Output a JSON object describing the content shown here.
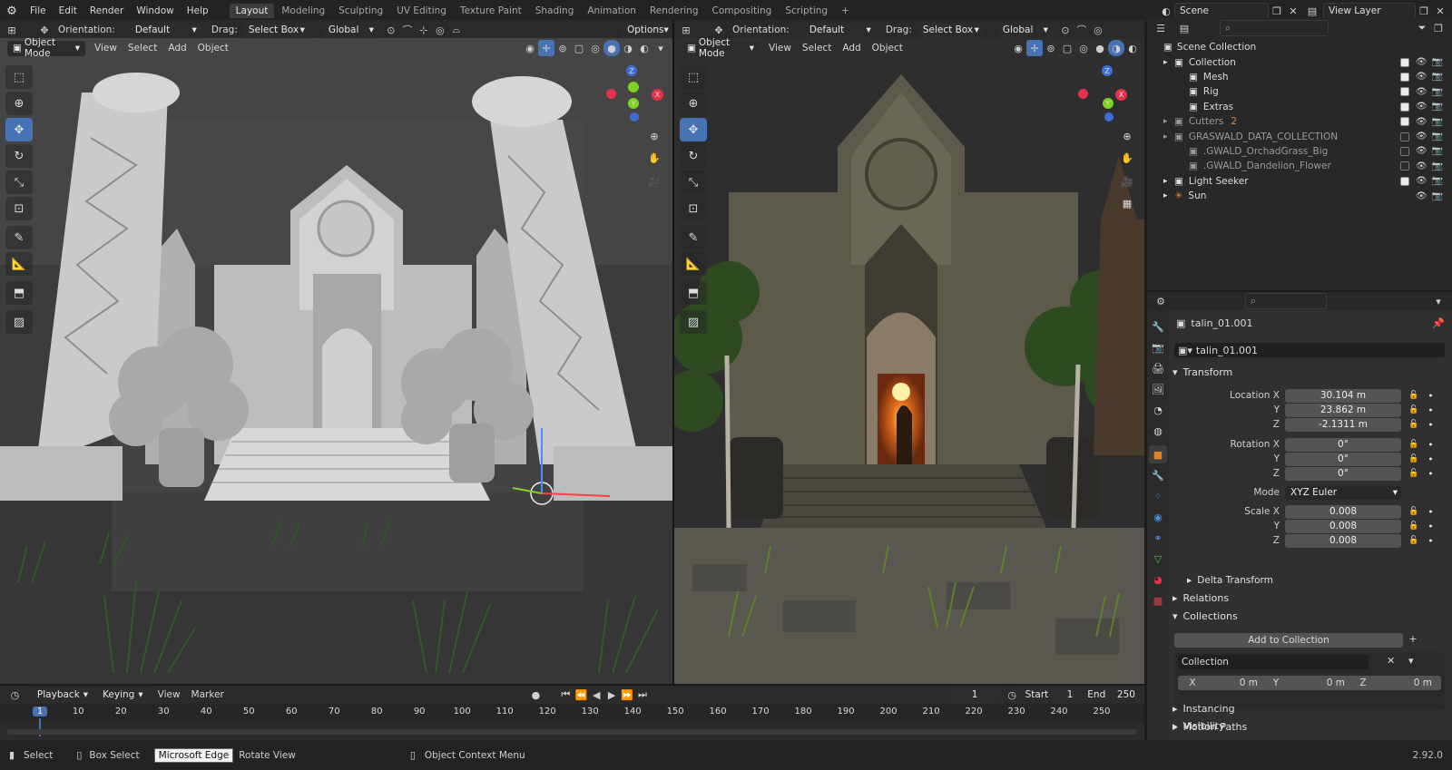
{
  "menubar": {
    "items": [
      "File",
      "Edit",
      "Render",
      "Window",
      "Help"
    ],
    "workspaces": [
      "Layout",
      "Modeling",
      "Sculpting",
      "UV Editing",
      "Texture Paint",
      "Shading",
      "Animation",
      "Rendering",
      "Compositing",
      "Scripting"
    ],
    "active_workspace": "Layout",
    "add_tab": "+",
    "scene": "Scene",
    "view_layer": "View Layer"
  },
  "toolheader": {
    "orientation_label": "Orientation:",
    "orientation_value": "Default",
    "drag_label": "Drag:",
    "drag_value": "Select Box",
    "transform_value": "Global",
    "options": "Options"
  },
  "viewport_header": {
    "mode": "Object Mode",
    "menus": [
      "View",
      "Select",
      "Add",
      "Object"
    ]
  },
  "timeline": {
    "menus": [
      "Playback",
      "Keying",
      "View",
      "Marker"
    ],
    "current_frame": "1",
    "start_label": "Start",
    "start": "1",
    "end_label": "End",
    "end": "250",
    "ticks": [
      "1",
      "10",
      "20",
      "30",
      "40",
      "50",
      "60",
      "70",
      "80",
      "90",
      "100",
      "110",
      "120",
      "130",
      "140",
      "150",
      "160",
      "170",
      "180",
      "190",
      "200",
      "210",
      "220",
      "230",
      "240",
      "250"
    ]
  },
  "statusbar": {
    "select": "Select",
    "box_select": "Box Select",
    "tooltip": "Microsoft Edge",
    "rotate": "Rotate View",
    "context": "Object Context Menu",
    "version": "2.92.0"
  },
  "outliner": {
    "root": "Scene Collection",
    "items": [
      {
        "label": "Collection",
        "checked": true
      },
      {
        "label": "Mesh",
        "checked": true
      },
      {
        "label": "Rig",
        "checked": true
      },
      {
        "label": "Extras",
        "checked": true
      },
      {
        "label": "Cutters",
        "checked": true,
        "badge": "2"
      },
      {
        "label": "GRASWALD_DATA_COLLECTION",
        "checked": false
      },
      {
        "label": ".GWALD_OrchadGrass_Big",
        "checked": false
      },
      {
        "label": ".GWALD_Dandelion_Flower",
        "checked": false
      },
      {
        "label": "Light Seeker",
        "checked": true
      },
      {
        "label": "Sun",
        "checked": null
      }
    ]
  },
  "properties": {
    "object_name": "talin_01.001",
    "data_name": "talin_01.001",
    "transform_label": "Transform",
    "location_x_label": "Location X",
    "location": [
      "30.104 m",
      "23.862 m",
      "-2.1311 m"
    ],
    "rotation_x_label": "Rotation X",
    "rotation": [
      "0°",
      "0°",
      "0°"
    ],
    "mode_label": "Mode",
    "mode_value": "XYZ Euler",
    "scale_x_label": "Scale X",
    "scale": [
      "0.008",
      "0.008",
      "0.008"
    ],
    "y": "Y",
    "z": "Z",
    "x": "X",
    "delta": "Delta Transform",
    "relations": "Relations",
    "collections": "Collections",
    "add_to_collection": "Add to Collection",
    "collection_name": "Collection",
    "offsets": [
      "0 m",
      "0 m",
      "0 m"
    ],
    "instancing": "Instancing",
    "motion_paths": "Motion Paths",
    "visibility": "Visibility"
  },
  "colors": {
    "accent": "#4772b3",
    "orange": "#e0822a",
    "bg": "#1d1d1d"
  }
}
